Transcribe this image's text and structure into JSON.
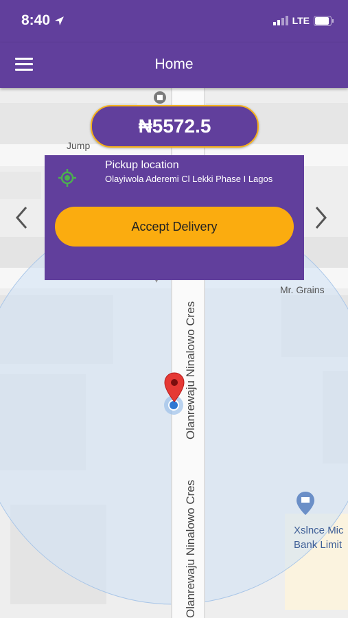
{
  "status_bar": {
    "time": "8:40",
    "network": "LTE"
  },
  "header": {
    "title": "Home"
  },
  "price": {
    "amount": "₦5572.5"
  },
  "pickup": {
    "label": "Pickup location",
    "address": "Olayiwola Aderemi Cl Lekki Phase I Lagos"
  },
  "actions": {
    "accept_label": "Accept Delivery"
  },
  "map": {
    "street_name": "Olanrewaju Ninalowo Cres",
    "street_name_bottom": "Olanrewaju Ninalowo Cres",
    "place_jump": "Jump",
    "place_grains": "Mr. Grains",
    "poi_line1": "Xslnce Mic",
    "poi_line2": "Bank Limit"
  },
  "colors": {
    "brand_purple": "#613f9c",
    "accent_orange": "#fbac0f"
  },
  "icons": [
    "location-arrow-icon",
    "signal-icon",
    "battery-icon",
    "menu-icon",
    "target-icon",
    "chevron-left-icon",
    "chevron-right-icon",
    "map-pin-icon",
    "bank-icon",
    "bookstore-icon"
  ]
}
